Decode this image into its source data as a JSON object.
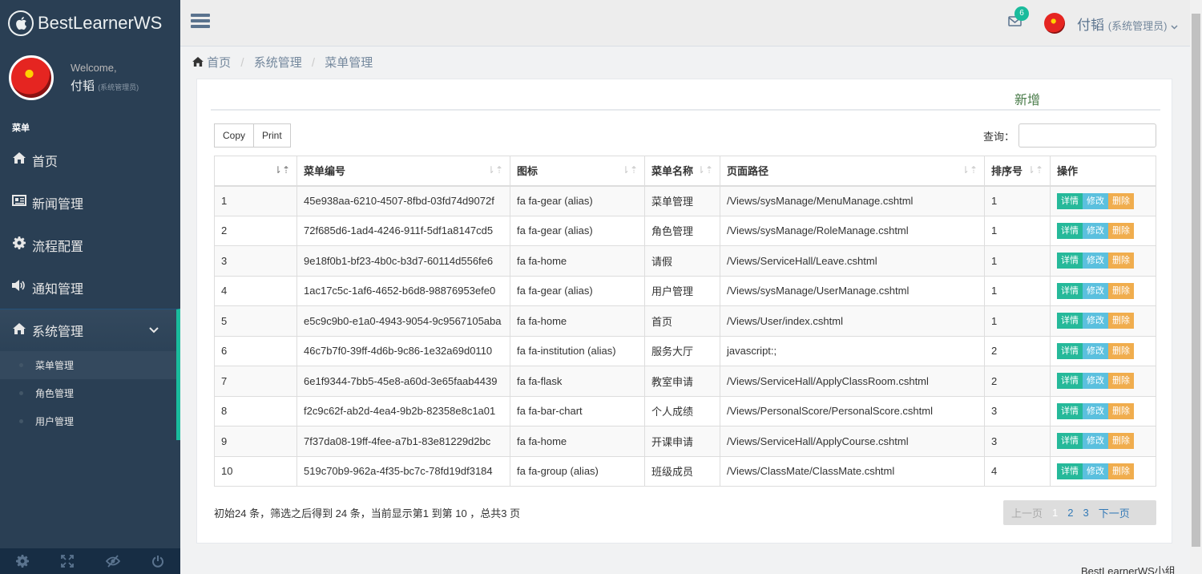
{
  "brand": {
    "name": "BestLearnerWS",
    "logo_icon": "apple-icon"
  },
  "profile": {
    "welcome": "Welcome,",
    "name": "付韬",
    "role": "(系统管理员)"
  },
  "sidebar": {
    "section": "菜单",
    "items": [
      {
        "label": "首页",
        "icon": "home-icon"
      },
      {
        "label": "新闻管理",
        "icon": "newspaper-icon"
      },
      {
        "label": "流程配置",
        "icon": "gear-icon"
      },
      {
        "label": "通知管理",
        "icon": "volume-icon"
      },
      {
        "label": "系统管理",
        "icon": "home-icon"
      }
    ],
    "children": [
      {
        "label": "菜单管理"
      },
      {
        "label": "角色管理"
      },
      {
        "label": "用户管理"
      }
    ],
    "footer_icons": [
      "settings-icon",
      "fullscreen-icon",
      "eye-slash-icon",
      "power-icon"
    ]
  },
  "topbar": {
    "mail_count": "6",
    "user_name": "付韬",
    "user_role": "(系统管理员)"
  },
  "breadcrumb": {
    "home": "首页",
    "level1": "系统管理",
    "level2": "菜单管理"
  },
  "panel": {
    "add_label": "新增",
    "buttons": {
      "copy": "Copy",
      "print": "Print"
    },
    "search_label": "查询："
  },
  "table": {
    "headers": [
      "",
      "菜单编号",
      "图标",
      "菜单名称",
      "页面路径",
      "排序号",
      "操作"
    ],
    "actions": {
      "detail": "详情",
      "edit": "修改",
      "delete": "删除"
    },
    "rows": [
      [
        "1",
        "45e938aa-6210-4507-8fbd-03fd74d9072f",
        "fa fa-gear (alias)",
        "菜单管理",
        "/Views/sysManage/MenuManage.cshtml",
        "1"
      ],
      [
        "2",
        "72f685d6-1ad4-4246-911f-5df1a8147cd5",
        "fa fa-gear (alias)",
        "角色管理",
        "/Views/sysManage/RoleManage.cshtml",
        "1"
      ],
      [
        "3",
        "9e18f0b1-bf23-4b0c-b3d7-60114d556fe6",
        "fa fa-home",
        "请假",
        "/Views/ServiceHall/Leave.cshtml",
        "1"
      ],
      [
        "4",
        "1ac17c5c-1af6-4652-b6d8-98876953efe0",
        "fa fa-gear (alias)",
        "用户管理",
        "/Views/sysManage/UserManage.cshtml",
        "1"
      ],
      [
        "5",
        "e5c9c9b0-e1a0-4943-9054-9c9567105aba",
        "fa fa-home",
        "首页",
        "/Views/User/index.cshtml",
        "1"
      ],
      [
        "6",
        "46c7b7f0-39ff-4d6b-9c86-1e32a69d0110",
        "fa fa-institution (alias)",
        "服务大厅",
        "javascript:;",
        "2"
      ],
      [
        "7",
        "6e1f9344-7bb5-45e8-a60d-3e65faab4439",
        "fa fa-flask",
        "教室申请",
        "/Views/ServiceHall/ApplyClassRoom.cshtml",
        "2"
      ],
      [
        "8",
        "f2c9c62f-ab2d-4ea4-9b2b-82358e8c1a01",
        "fa fa-bar-chart",
        "个人成绩",
        "/Views/PersonalScore/PersonalScore.cshtml",
        "3"
      ],
      [
        "9",
        "7f37da08-19ff-4fee-a7b1-83e81229d2bc",
        "fa fa-home",
        "开课申请",
        "/Views/ServiceHall/ApplyCourse.cshtml",
        "3"
      ],
      [
        "10",
        "519c70b9-962a-4f35-bc7c-78fd19df3184",
        "fa fa-group (alias)",
        "班级成员",
        "/Views/ClassMate/ClassMate.cshtml",
        "4"
      ]
    ]
  },
  "pagination": {
    "info": "初始24 条，筛选之后得到 24 条，当前显示第1 到第 10 ，总共3 页",
    "prev": "上一页",
    "pages": [
      "1",
      "2",
      "3"
    ],
    "next": "下一页"
  },
  "footer": {
    "text": "BestLearnerWS小组"
  },
  "colors": {
    "sidebar": "#2a3f54",
    "accent": "#1abb9c",
    "detail": "#26b99a",
    "edit": "#5bc0de",
    "delete": "#f0ad4e"
  }
}
